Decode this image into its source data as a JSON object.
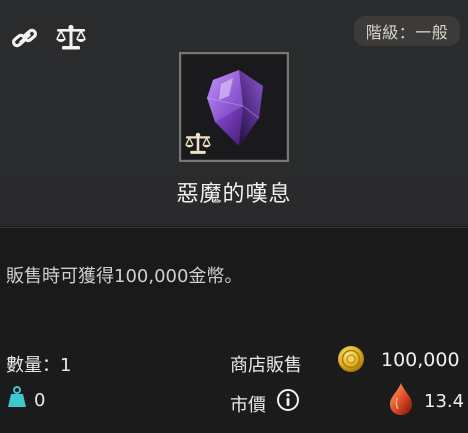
{
  "header": {
    "grade_label": "階級：一般"
  },
  "item": {
    "name": "惡魔的嘆息",
    "icon": "purple-gem",
    "tradeable_icon": "balance-scale"
  },
  "description": "販售時可獲得100,000金幣。",
  "stats": {
    "quantity_label": "數量：1",
    "weight_value": "0",
    "shop_sell_label": "商店販售",
    "shop_sell_price": "100,000",
    "market_price_label": "市價",
    "market_price_value": "13.4"
  },
  "colors": {
    "panel_bg": "#2b2c2e",
    "stats_bg": "#1b1b1c",
    "gem_purple": "#7a3fc0",
    "coin_gold": "#e0b01e",
    "weight_teal": "#3dc7cf",
    "blood_red": "#e05028"
  }
}
